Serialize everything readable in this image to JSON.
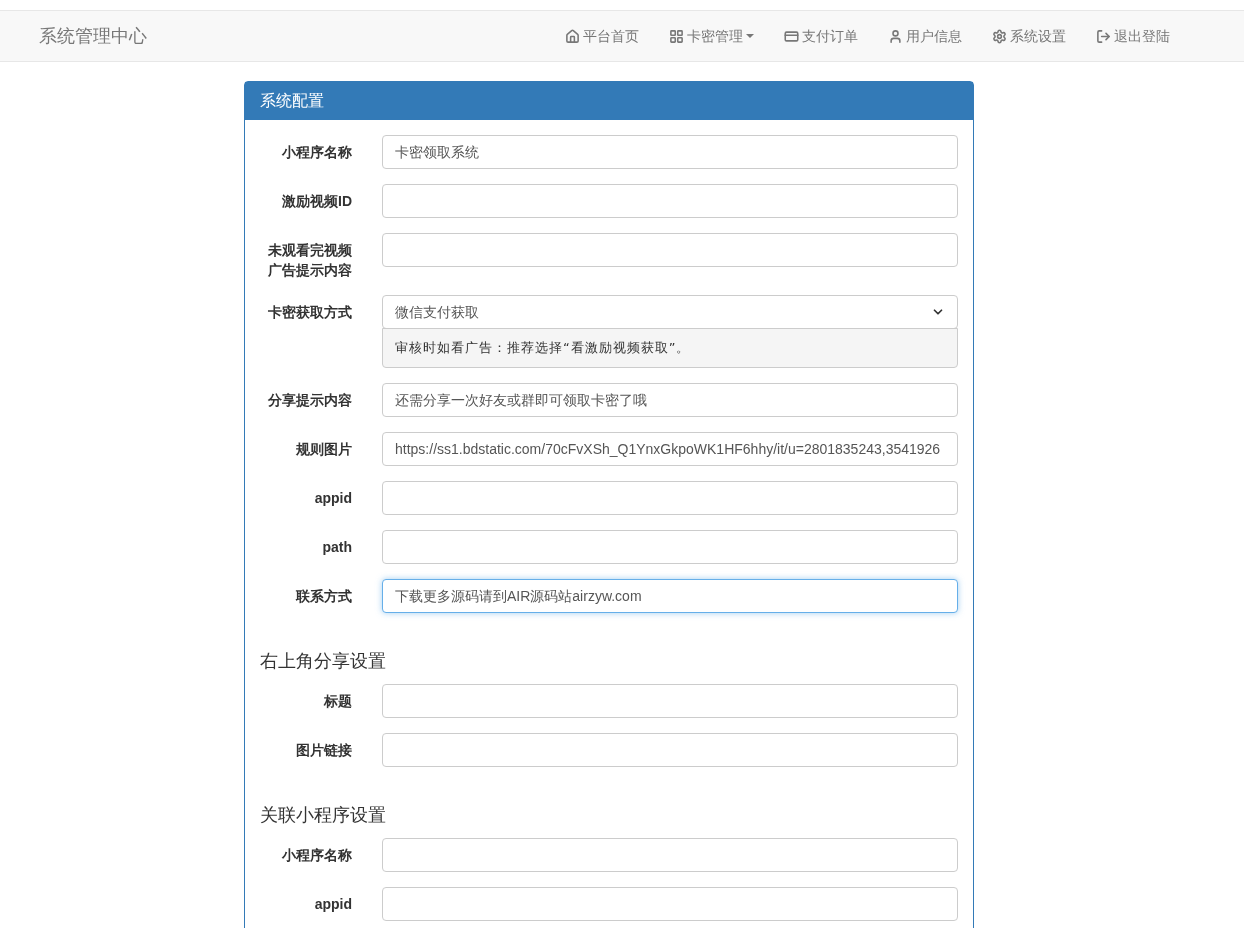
{
  "navbar": {
    "brand": "系统管理中心",
    "items": [
      {
        "label": "平台首页",
        "dropdown": false
      },
      {
        "label": "卡密管理",
        "dropdown": true
      },
      {
        "label": "支付订单",
        "dropdown": false
      },
      {
        "label": "用户信息",
        "dropdown": false
      },
      {
        "label": "系统设置",
        "dropdown": false
      },
      {
        "label": "退出登陆",
        "dropdown": false
      }
    ]
  },
  "panel": {
    "title": "系统配置",
    "sections": [
      {
        "fields": [
          {
            "kind": "text",
            "label": "小程序名称",
            "value": "卡密领取系统",
            "focused": false
          },
          {
            "kind": "text",
            "label": "激励视频ID",
            "focused": false
          },
          {
            "kind": "text",
            "label": "未观看完视频广告提示内容",
            "focused": false
          },
          {
            "kind": "select",
            "label": "卡密获取方式",
            "value": "微信支付获取",
            "help": "审核时如看广告：推荐选择“看激励视频获取”。",
            "focused": false
          },
          {
            "kind": "text",
            "label": "分享提示内容",
            "value": "还需分享一次好友或群即可领取卡密了哦",
            "focused": false
          },
          {
            "kind": "text",
            "label": "规则图片",
            "value": "https://ss1.bdstatic.com/70cFvXSh_Q1YnxGkpoWK1HF6hhy/it/u=2801835243,3541926",
            "focused": false
          },
          {
            "kind": "text",
            "label": "appid",
            "focused": false
          },
          {
            "kind": "text",
            "label": "path",
            "focused": false
          },
          {
            "kind": "text",
            "label": "联系方式",
            "value": "下载更多源码请到AIR源码站airzyw.com",
            "focused": true
          }
        ]
      },
      {
        "heading": "右上角分享设置",
        "fields": [
          {
            "kind": "text",
            "label": "标题",
            "focused": false
          },
          {
            "kind": "text",
            "label": "图片链接",
            "focused": false
          }
        ]
      },
      {
        "heading": "关联小程序设置",
        "fields": [
          {
            "kind": "text",
            "label": "小程序名称",
            "focused": false
          },
          {
            "kind": "text",
            "label": "appid",
            "focused": false
          }
        ]
      }
    ]
  }
}
